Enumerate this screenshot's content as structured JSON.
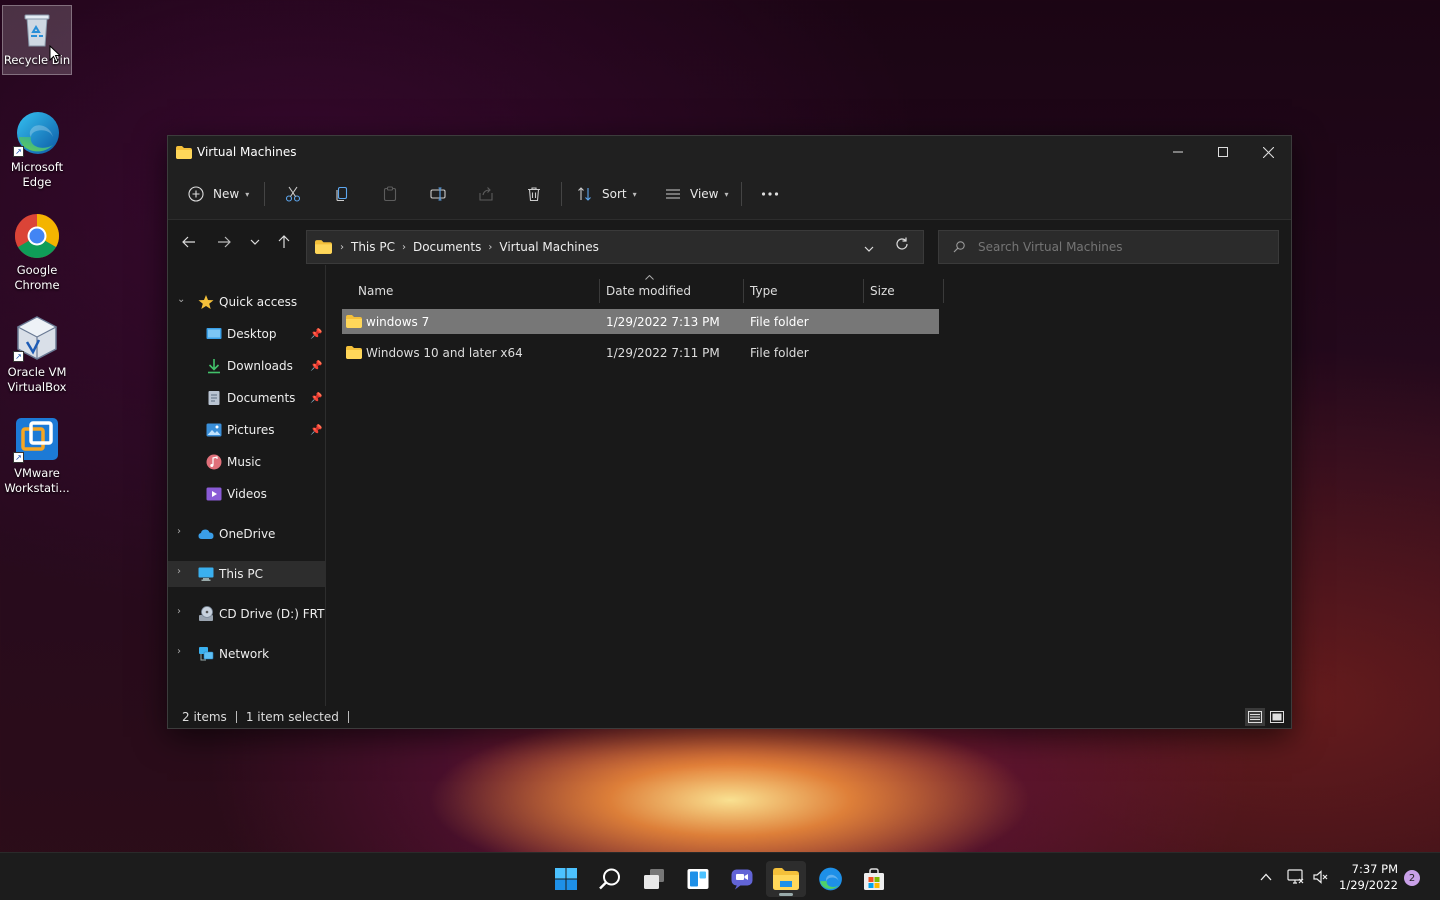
{
  "desktop": {
    "icons": [
      {
        "label": "Recycle Bin"
      },
      {
        "label": "Microsoft Edge"
      },
      {
        "label": "Google Chrome"
      },
      {
        "label": "Oracle VM VirtualBox"
      },
      {
        "label": "VMware Workstati..."
      }
    ]
  },
  "window": {
    "title": "Virtual Machines",
    "toolbar": {
      "new_label": "New",
      "sort_label": "Sort",
      "view_label": "View",
      "more_label": "…"
    },
    "address": {
      "crumbs": [
        "This PC",
        "Documents",
        "Virtual Machines"
      ]
    },
    "search": {
      "placeholder": "Search Virtual Machines"
    },
    "navpane": {
      "quick_access": "Quick access",
      "items": [
        {
          "label": "Desktop"
        },
        {
          "label": "Downloads"
        },
        {
          "label": "Documents"
        },
        {
          "label": "Pictures"
        },
        {
          "label": "Music"
        },
        {
          "label": "Videos"
        }
      ],
      "onedrive": "OneDrive",
      "thispc": "This PC",
      "cddrive": "CD Drive (D:) FRTME",
      "network": "Network"
    },
    "columns": {
      "name": "Name",
      "date": "Date modified",
      "type": "Type",
      "size": "Size"
    },
    "files": [
      {
        "name": "windows 7",
        "date": "1/29/2022 7:13 PM",
        "type": "File folder",
        "size": ""
      },
      {
        "name": "Windows 10 and later x64",
        "date": "1/29/2022 7:11 PM",
        "type": "File folder",
        "size": ""
      }
    ],
    "status": {
      "count": "2 items",
      "selected": "1 item selected"
    }
  },
  "taskbar": {
    "time": "7:37 PM",
    "date": "1/29/2022",
    "notifications": "2"
  },
  "colors": {
    "accent": "#0078d4",
    "folder": "#f4c03a",
    "selection": "#777777"
  }
}
